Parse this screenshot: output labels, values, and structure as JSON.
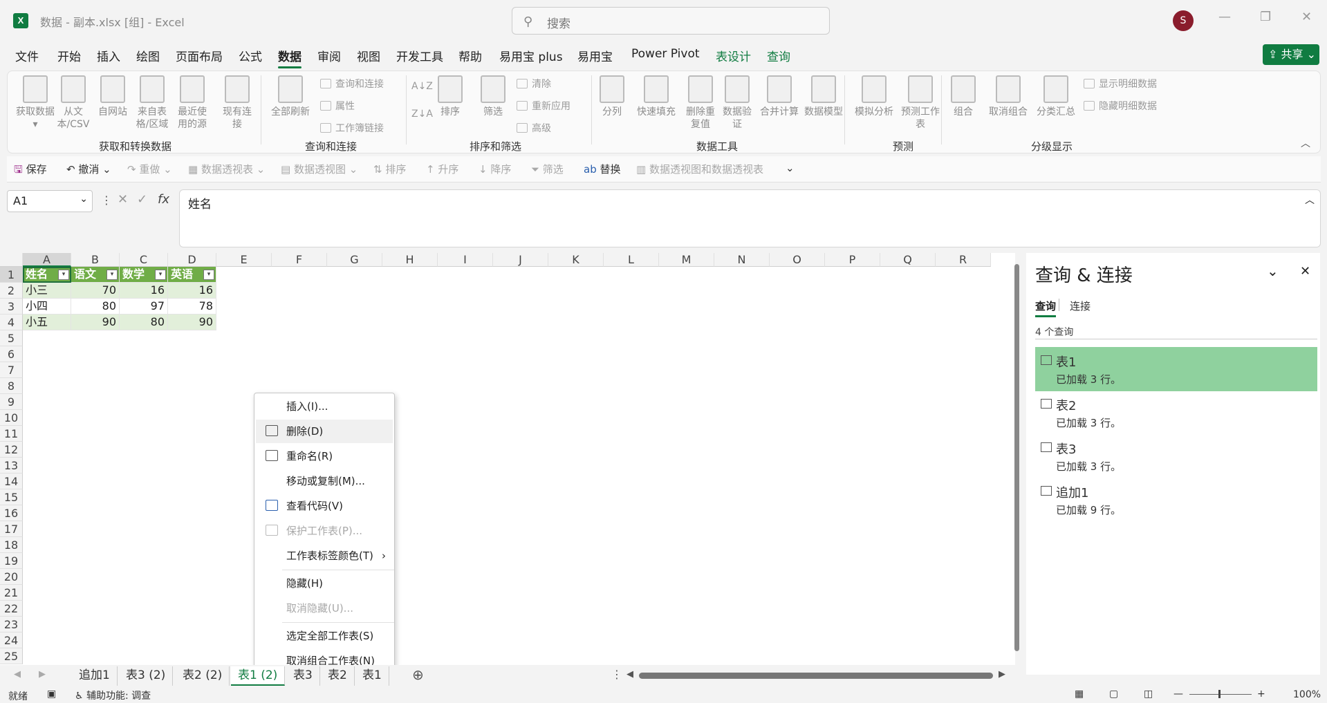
{
  "title": {
    "filename": "数据 - 副本.xlsx [组] - Excel",
    "search_placeholder": "搜索",
    "avatar": "S",
    "min": "—",
    "max": "❐",
    "close": "✕"
  },
  "menu": [
    "文件",
    "开始",
    "插入",
    "绘图",
    "页面布局",
    "公式",
    "数据",
    "审阅",
    "视图",
    "开发工具",
    "帮助",
    "易用宝 plus",
    "易用宝",
    "Power Pivot",
    "表设计",
    "查询"
  ],
  "share": "共享",
  "ribbon": {
    "get_data": "获取数据▾",
    "from_csv": "从文本/CSV",
    "from_web": "自网站",
    "from_table": "来自表格/区域",
    "recent": "最近使用的源",
    "existing": "现有连接",
    "group1": "获取和转换数据",
    "refresh_all": "全部刷新",
    "queries_conn": "查询和连接",
    "properties": "属性",
    "workbook_links": "工作簿链接",
    "group2": "查询和连接",
    "sort": "排序",
    "group3": "排序和筛选",
    "filter": "筛选",
    "clear": "清除",
    "reapply": "重新应用",
    "advanced": "高级",
    "split": "分列",
    "flash_fill": "快速填充",
    "remove_dup": "删除重复值",
    "validation": "数据验证",
    "consolidate": "合并计算",
    "data_model": "数据模型",
    "group4": "数据工具",
    "what_if": "模拟分析",
    "forecast": "预测工作表",
    "group5": "预测",
    "group_btn": "组合",
    "ungroup": "取消组合",
    "subtotal": "分类汇总",
    "show_detail": "显示明细数据",
    "hide_detail": "隐藏明细数据",
    "group6": "分级显示"
  },
  "qat": {
    "save": "保存",
    "undo": "撤消",
    "redo": "重做",
    "pivot": "数据透视表",
    "pivot_chart": "数据透视图",
    "sort": "排序",
    "asc": "升序",
    "desc": "降序",
    "filter": "筛选",
    "replace": "替换",
    "pivot_both": "数据透视图和数据透视表"
  },
  "formula": {
    "namebox": "A1",
    "fx": "fx",
    "content": "姓名"
  },
  "sheet": {
    "columns": [
      "A",
      "B",
      "C",
      "D",
      "E",
      "F",
      "G",
      "H",
      "I",
      "J",
      "K",
      "L",
      "M",
      "N",
      "O",
      "P",
      "Q",
      "R"
    ],
    "rows": [
      "1",
      "2",
      "3",
      "4",
      "5",
      "6",
      "7",
      "8",
      "9",
      "10",
      "11",
      "12",
      "13",
      "14",
      "15",
      "16",
      "17",
      "18",
      "19",
      "20",
      "21",
      "22",
      "23",
      "24",
      "25"
    ],
    "headers": [
      "姓名",
      "语文",
      "数学",
      "英语"
    ],
    "data": [
      [
        "小三",
        "70",
        "16",
        "16"
      ],
      [
        "小四",
        "80",
        "97",
        "78"
      ],
      [
        "小五",
        "90",
        "80",
        "90"
      ]
    ]
  },
  "context_menu": {
    "insert": "插入(I)...",
    "delete": "删除(D)",
    "rename": "重命名(R)",
    "move_copy": "移动或复制(M)...",
    "view_code": "查看代码(V)",
    "protect": "保护工作表(P)...",
    "tab_color": "工作表标签颜色(T)",
    "hide": "隐藏(H)",
    "unhide": "取消隐藏(U)...",
    "select_all": "选定全部工作表(S)",
    "ungroup": "取消组合工作表(N)"
  },
  "panel": {
    "title": "查询 & 连接",
    "tab_queries": "查询",
    "tab_conn": "连接",
    "count": "4 个查询",
    "items": [
      {
        "name": "表1",
        "status": "已加载 3 行。"
      },
      {
        "name": "表2",
        "status": "已加载 3 行。"
      },
      {
        "name": "表3",
        "status": "已加载 3 行。"
      },
      {
        "name": "追加1",
        "status": "已加载 9 行。"
      }
    ]
  },
  "tabs": [
    "追加1",
    "表3 (2)",
    "表2 (2)",
    "表1 (2)",
    "表3",
    "表2",
    "表1"
  ],
  "status": {
    "ready": "就绪",
    "accessibility": "辅助功能: 调查",
    "zoom": "100%"
  }
}
